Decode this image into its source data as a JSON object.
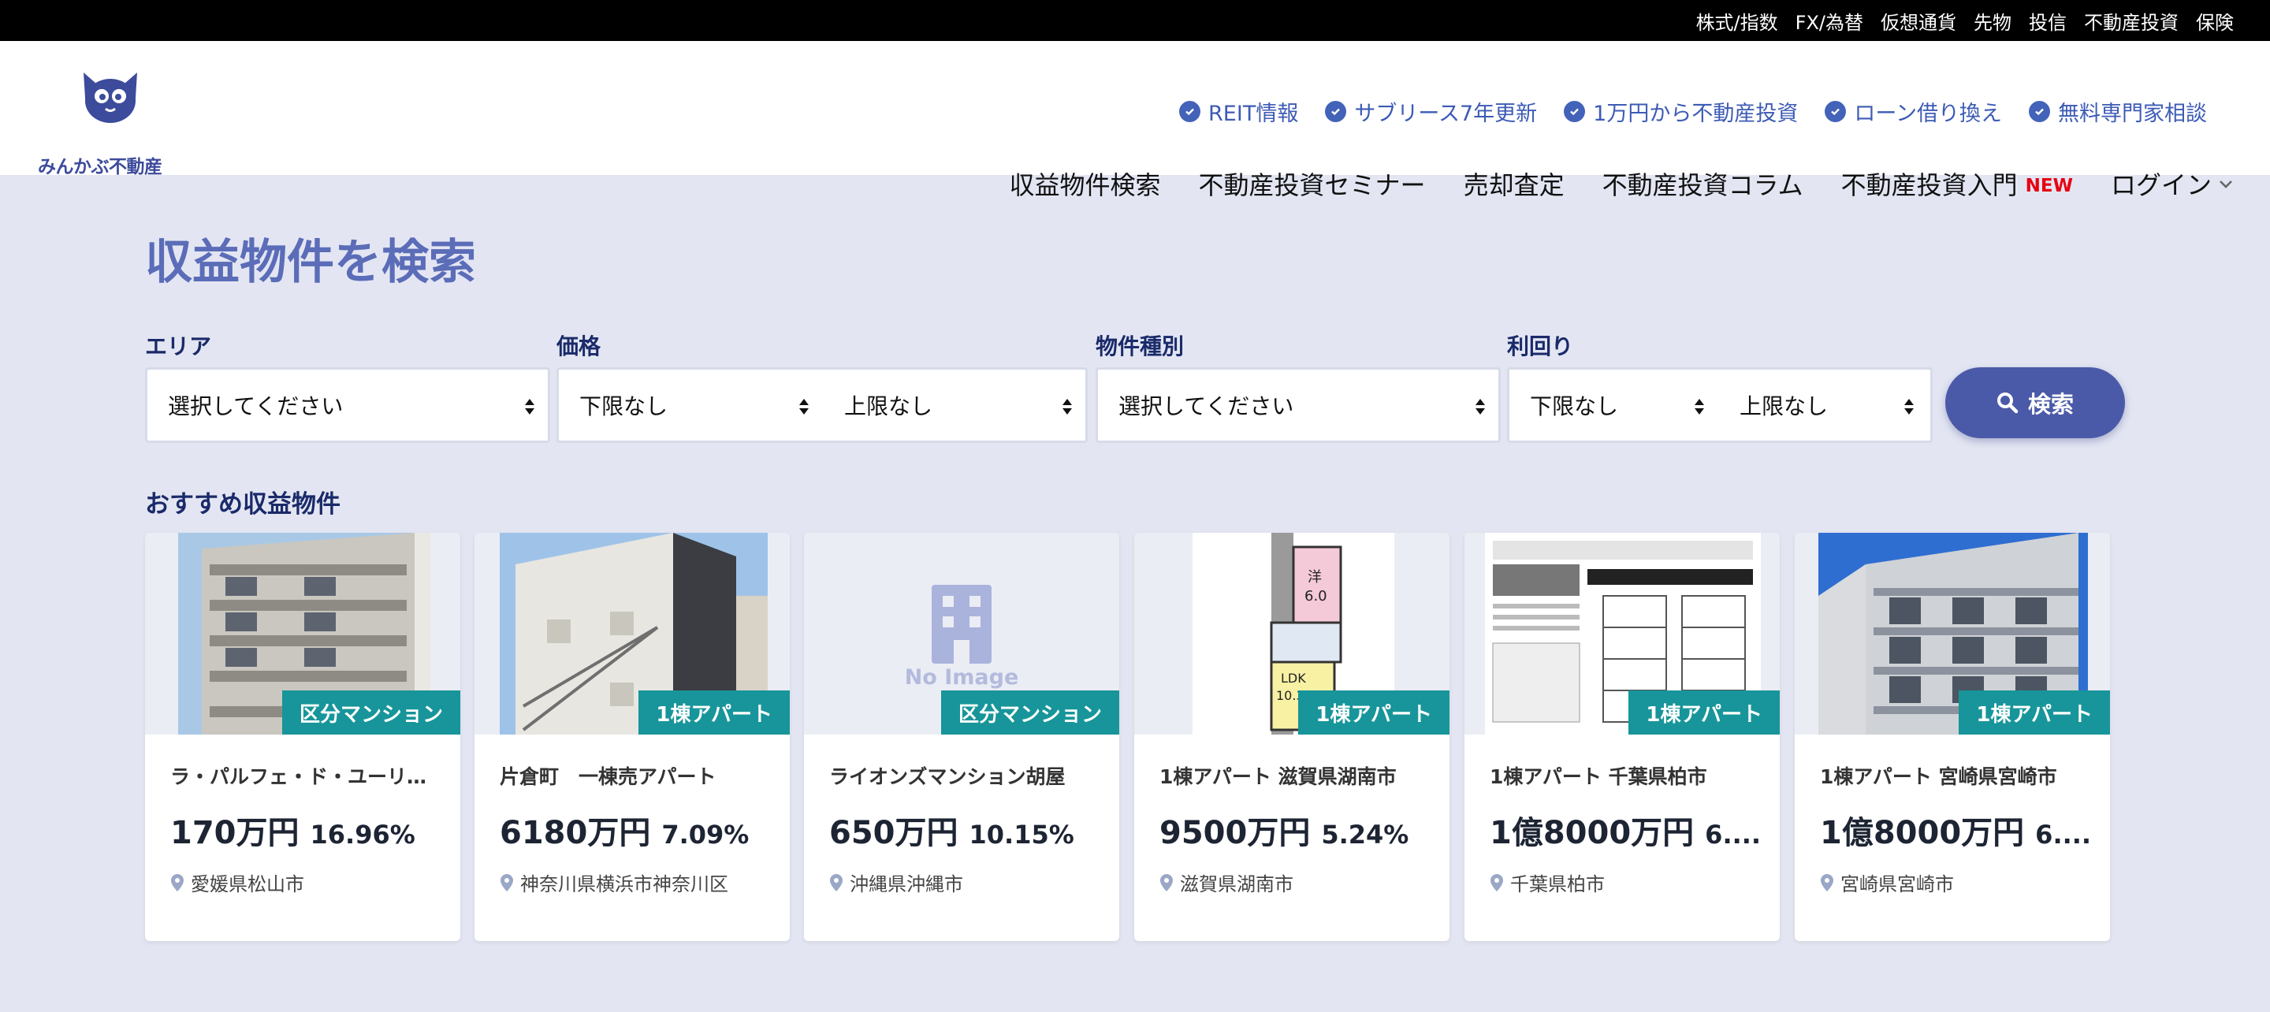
{
  "topbar": {
    "links": [
      "株式/指数",
      "FX/為替",
      "仮想通貨",
      "先物",
      "投信",
      "不動産投資",
      "保険"
    ]
  },
  "header": {
    "logo_text": "みんかぶ不動産",
    "sub_links": [
      "REIT情報",
      "サブリース7年更新",
      "1万円から不動産投資",
      "ローン借り換え",
      "無料専門家相談"
    ],
    "nav": {
      "search": "収益物件検索",
      "seminar": "不動産投資セミナー",
      "sale": "売却査定",
      "column": "不動産投資コラム",
      "intro": "不動産投資入門",
      "new_badge": "NEW",
      "login": "ログイン"
    }
  },
  "search": {
    "title": "収益物件を検索",
    "area_label": "エリア",
    "area_value": "選択してください",
    "price_label": "価格",
    "price_min": "下限なし",
    "price_max": "上限なし",
    "type_label": "物件種別",
    "type_value": "選択してください",
    "yield_label": "利回り",
    "yield_min": "下限なし",
    "yield_max": "上限なし",
    "button": "検索"
  },
  "recommended": {
    "title": "おすすめ収益物件",
    "no_image_text": "No Image",
    "cards": [
      {
        "badge": "区分マンション",
        "name": "ラ・パルフェ・ド・ユーリス...",
        "price": "170万円",
        "yield": "16.96%",
        "location": "愛媛県松山市"
      },
      {
        "badge": "1棟アパート",
        "name": "片倉町　一棟売アパート",
        "price": "6180万円",
        "yield": "7.09%",
        "location": "神奈川県横浜市神奈川区"
      },
      {
        "badge": "区分マンション",
        "name": "ライオンズマンション胡屋",
        "price": "650万円",
        "yield": "10.15%",
        "location": "沖縄県沖縄市"
      },
      {
        "badge": "1棟アパート",
        "name": "1棟アパート 滋賀県湖南市",
        "price": "9500万円",
        "yield": "5.24%",
        "location": "滋賀県湖南市"
      },
      {
        "badge": "1棟アパート",
        "name": "1棟アパート 千葉県柏市",
        "price": "1億8000万円",
        "yield": "6....",
        "location": "千葉県柏市"
      },
      {
        "badge": "1棟アパート",
        "name": "1棟アパート 宮崎県宮崎市",
        "price": "1億8000万円",
        "yield": "6....",
        "location": "宮崎県宮崎市"
      }
    ]
  },
  "colors": {
    "brand": "#3d4b9c",
    "accent_link": "#3d5bb5",
    "badge": "#17959a",
    "background": "#e3e6f2",
    "new": "#e60012"
  }
}
